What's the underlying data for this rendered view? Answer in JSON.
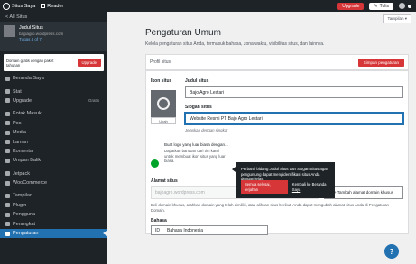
{
  "adminbar": {
    "site_label": "Situs Saya",
    "reader_label": "Reader",
    "upgrade_label": "Upgrade",
    "tulis_label": "Tulis"
  },
  "sidebar": {
    "back_label": "< All Situs",
    "site_name": "Judul Situs",
    "site_url": "bagiagro.wordpress.com",
    "site_tag": "Tugas 4 of 7",
    "domain_text": "Domain gratis dengan paket tahunan",
    "domain_button": "Upgrade",
    "items": [
      {
        "label": "Beranda Saya",
        "badge": ""
      },
      {
        "label": "Stat",
        "badge": ""
      },
      {
        "label": "Upgrade",
        "badge": "Gratis"
      },
      {
        "label": "Kotak Masuk",
        "badge": ""
      },
      {
        "label": "Pos",
        "badge": ""
      },
      {
        "label": "Media",
        "badge": ""
      },
      {
        "label": "Laman",
        "badge": ""
      },
      {
        "label": "Komentar",
        "badge": ""
      },
      {
        "label": "Umpan Balik",
        "badge": ""
      },
      {
        "label": "Jetpack",
        "badge": ""
      },
      {
        "label": "WooCommerce",
        "badge": ""
      },
      {
        "label": "Tampilan",
        "badge": ""
      },
      {
        "label": "Plugin",
        "badge": ""
      },
      {
        "label": "Pengguna",
        "badge": ""
      },
      {
        "label": "Perangkat",
        "badge": ""
      },
      {
        "label": "Pengaturan",
        "badge": ""
      }
    ]
  },
  "main": {
    "tampilan_label": "Tampilan ▾",
    "title": "Pengaturan Umum",
    "description": "Kelola pengaturan situs Anda, termasuk bahasa, zona waktu, visibilitas situs, dan lainnya.",
    "profile_header": "Profil situs",
    "save_button": "Simpan pengaturan",
    "icon_label": "Ikon situs",
    "icon_button": "Ubah",
    "title_label": "Judul situs",
    "title_value": "Bajo Agro Lestari",
    "tagline_label": "Slogan situs",
    "tagline_value": "Website Resmi PT Bajo Agro Lestari",
    "tagline_help": "Jelaskan dengan singkat",
    "lang_heading": "Buat logo yang luar biasa dengan...",
    "lang_body": "Dapatkan bantuan dari tim kami untuk membuat ikon situs yang luar biasa.",
    "address_label": "Alamat situs",
    "address_value": "bajoagro.wordpress.com",
    "add_domain": "+ Tambah alamat domain khusus",
    "address_help": "Beli domain khusus, arahkan domain yang telah dimiliki, atau alihkan situs berikut. Anda dapat mengubah alamat situs Anda di Pengaturan Domain.",
    "lang_label": "Bahasa",
    "lang_code": "ID",
    "lang_value": "Bahasa Indonesia",
    "lang_help": "Bahasa utama situs Anda, juga menentukan bahasa yang perlu dipilih",
    "help_fab": "?"
  },
  "tooltip": {
    "text": "Perbarui bidang Judul Situs dan Slogan Situs agar pengunjung dapat mengidentifikasi situs Anda dengan jelas.",
    "primary": "Semua selesai, terjahan",
    "secondary": "Kembali ke Beranda Saya"
  }
}
